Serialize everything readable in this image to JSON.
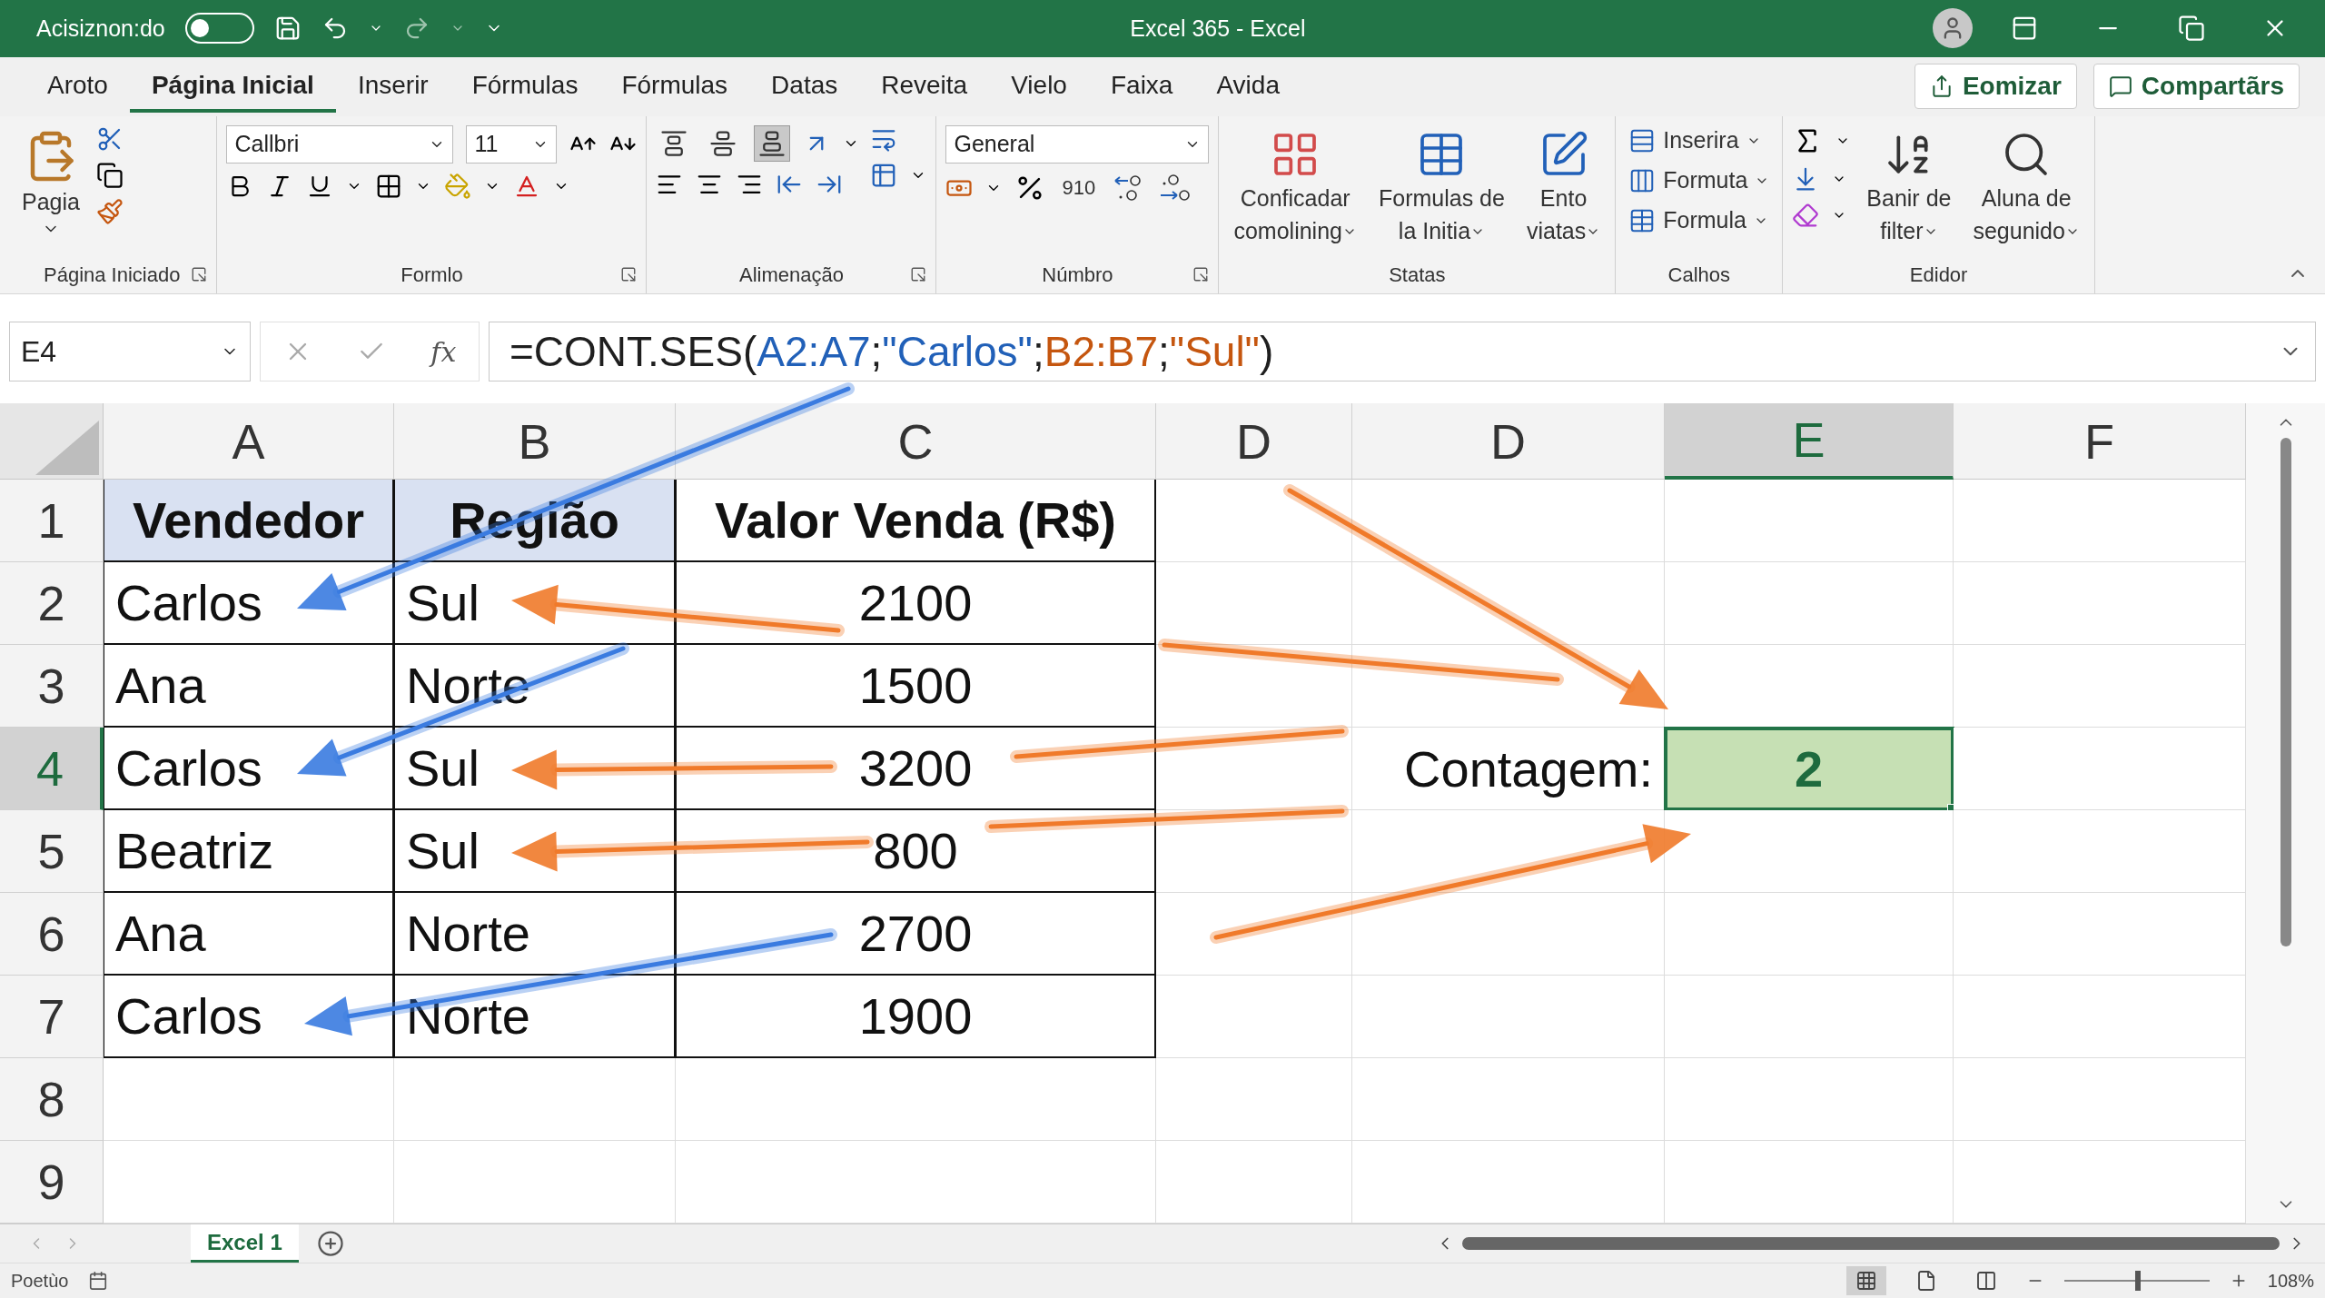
{
  "title_bar": {
    "autosave_label": "Acisiznon:do",
    "autosave_on": false,
    "title": "Excel 365  -  Excel"
  },
  "menu_tabs": [
    {
      "label": "Aroto",
      "selected": false
    },
    {
      "label": "Página Inicial",
      "selected": true
    },
    {
      "label": "Inserir",
      "selected": false
    },
    {
      "label": "Fórmulas",
      "selected": false
    },
    {
      "label": "Fórmulas",
      "selected": false
    },
    {
      "label": "Datas",
      "selected": false
    },
    {
      "label": "Reveita",
      "selected": false
    },
    {
      "label": "Vielo",
      "selected": false
    },
    {
      "label": "Faixa",
      "selected": false
    },
    {
      "label": "Avida",
      "selected": false
    }
  ],
  "actions": [
    {
      "kind": "share",
      "label": "Eomizar"
    },
    {
      "kind": "comment",
      "label": "Compartãrs"
    }
  ],
  "ribbon": {
    "groups": [
      {
        "kind": "clipboard",
        "name": "Página Iniciado",
        "launcher": true,
        "paste_label": "Pagia"
      },
      {
        "kind": "font",
        "name": "Formlo",
        "launcher": true,
        "font": "Callbri",
        "size": "11"
      },
      {
        "kind": "alignment",
        "name": "Alimenação",
        "launcher": true,
        "vertical_align": [
          {
            "selected": false
          },
          {
            "selected": false
          },
          {
            "selected": true
          }
        ]
      },
      {
        "kind": "number",
        "name": "Númbro",
        "launcher": true,
        "format": "General",
        "comma": "910"
      },
      {
        "kind": "styles",
        "name": "Statas",
        "launcher": false,
        "buttons": [
          {
            "lines": [
              "Conficadar",
              "comolining"
            ]
          },
          {
            "lines": [
              "Formulas de",
              "la Initia"
            ]
          },
          {
            "lines": [
              "Ento",
              "viatas"
            ]
          }
        ]
      },
      {
        "kind": "cells",
        "name": "Calhos",
        "launcher": false,
        "items": [
          "Inserira",
          "Formuta",
          "Formula"
        ]
      },
      {
        "kind": "editing",
        "name": "Edidor",
        "launcher": false,
        "buttons": [
          {
            "lines": [
              "Banir de",
              "filter"
            ]
          },
          {
            "lines": [
              "Aluna de",
              "segunido"
            ]
          }
        ]
      }
    ]
  },
  "formula_bar": {
    "name_box": "E4",
    "fx_label": "fx",
    "formula": [
      {
        "text": "=CONT.SES(",
        "color": "#1f1f1f"
      },
      {
        "text": "A2:A7",
        "color": "#2160b8"
      },
      {
        "text": ";",
        "color": "#1f1f1f"
      },
      {
        "text": "\"Carlos\"",
        "color": "#2160b8"
      },
      {
        "text": ";",
        "color": "#1f1f1f"
      },
      {
        "text": "B2:B7",
        "color": "#c5560f"
      },
      {
        "text": ";",
        "color": "#1f1f1f"
      },
      {
        "text": "\"Sul\"",
        "color": "#c5560f"
      },
      {
        "text": ")",
        "color": "#1f1f1f"
      }
    ]
  },
  "sheet": {
    "columns": [
      {
        "label": "A",
        "selected": false
      },
      {
        "label": "B",
        "selected": false
      },
      {
        "label": "C",
        "selected": false
      },
      {
        "label": "D",
        "selected": false
      },
      {
        "label": "D",
        "selected": false
      },
      {
        "label": "E",
        "selected": true
      },
      {
        "label": "F",
        "selected": false
      }
    ],
    "rows": [
      {
        "label": "1",
        "selected": false,
        "cells": [
          {
            "kind": "head",
            "text": "Vendedor",
            "shaded": true
          },
          {
            "kind": "head",
            "text": "Região",
            "shaded": true
          },
          {
            "kind": "head",
            "text": "Valor Venda (R$)",
            "shaded": false
          },
          null,
          null,
          null,
          null
        ]
      },
      {
        "label": "2",
        "selected": false,
        "cells": [
          {
            "kind": "text",
            "text": "Carlos"
          },
          {
            "kind": "text",
            "text": "Sul"
          },
          {
            "kind": "number",
            "text": "2100"
          },
          null,
          null,
          null,
          null
        ]
      },
      {
        "label": "3",
        "selected": false,
        "cells": [
          {
            "kind": "text",
            "text": "Ana"
          },
          {
            "kind": "text",
            "text": "Norte"
          },
          {
            "kind": "number",
            "text": "1500"
          },
          null,
          null,
          null,
          null
        ]
      },
      {
        "label": "4",
        "selected": true,
        "cells": [
          {
            "kind": "text",
            "text": "Carlos"
          },
          {
            "kind": "text",
            "text": "Sul"
          },
          {
            "kind": "number",
            "text": "3200"
          },
          null,
          {
            "kind": "label",
            "text": "Contagem:"
          },
          {
            "kind": "result",
            "text": "2",
            "selected": true
          },
          null
        ]
      },
      {
        "label": "5",
        "selected": false,
        "cells": [
          {
            "kind": "text",
            "text": "Beatriz"
          },
          {
            "kind": "text",
            "text": "Sul"
          },
          {
            "kind": "number",
            "text": "800"
          },
          null,
          null,
          null,
          null
        ]
      },
      {
        "label": "6",
        "selected": false,
        "cells": [
          {
            "kind": "text",
            "text": "Ana"
          },
          {
            "kind": "text",
            "text": "Norte"
          },
          {
            "kind": "number",
            "text": "2700"
          },
          null,
          null,
          null,
          null
        ]
      },
      {
        "label": "7",
        "selected": false,
        "cells": [
          {
            "kind": "text",
            "text": "Carlos"
          },
          {
            "kind": "text",
            "text": "Norte"
          },
          {
            "kind": "number",
            "text": "1900"
          },
          null,
          null,
          null,
          null
        ]
      },
      {
        "label": "8",
        "selected": false,
        "cells": [
          null,
          null,
          null,
          null,
          null,
          null,
          null
        ]
      },
      {
        "label": "9",
        "selected": false,
        "cells": [
          null,
          null,
          null,
          null,
          null,
          null,
          null
        ]
      }
    ]
  },
  "sheet_tabs": [
    {
      "label": "Excel 1",
      "selected": true
    }
  ],
  "status_bar": {
    "mode": "Poetùo",
    "zoom_slider": {
      "level": 0.51
    },
    "zoom": "108%"
  }
}
